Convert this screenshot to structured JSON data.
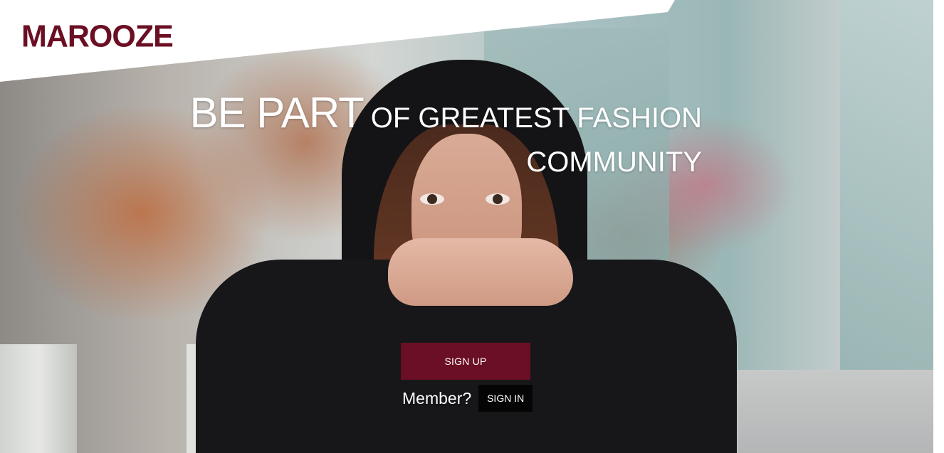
{
  "brand": {
    "logo_text": "MAROOZE",
    "color": "#6b0f24"
  },
  "hero": {
    "headline_emphasis": "BE PART",
    "headline_rest": "OF GREATEST FASHION",
    "headline_line2": "COMMUNITY",
    "image": "hooded-woman-photo"
  },
  "cta": {
    "signup_label": "SIGN UP",
    "member_prompt": "Member?",
    "signin_label": "SIGN IN"
  },
  "colors": {
    "primary": "#6b0f24",
    "signin_bg": "#050505",
    "text_on_dark": "#ffffff"
  }
}
